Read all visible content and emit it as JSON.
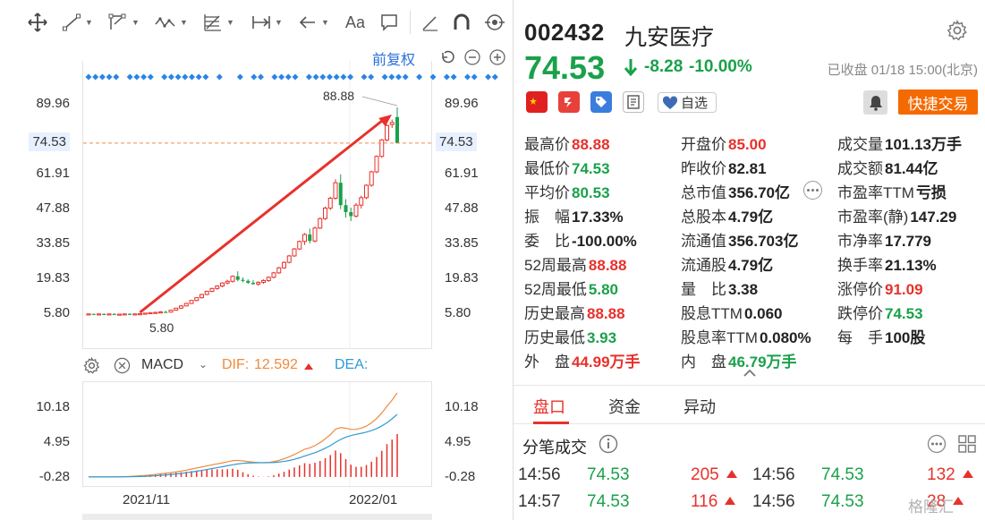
{
  "left": {
    "fq_label": "前复权",
    "axis_left": [
      "89.96",
      "74.53",
      "61.91",
      "47.88",
      "33.85",
      "19.83",
      "5.80"
    ],
    "axis_right": [
      "89.96",
      "74.53",
      "61.91",
      "47.88",
      "33.85",
      "19.83",
      "5.80"
    ],
    "high_marker": "88.88",
    "low_marker": "5.80",
    "macd": {
      "indicator": "MACD",
      "dif_label": "DIF:",
      "dif_value": "12.592",
      "dea_label": "DEA:",
      "axis_left": [
        "10.18",
        "4.95",
        "-0.28"
      ],
      "axis_right": [
        "10.18",
        "4.95",
        "-0.28"
      ]
    },
    "dates": [
      "2021/11",
      "2022/01"
    ]
  },
  "quote": {
    "code": "002432",
    "name": "九安医疗",
    "price": "74.53",
    "change": "-8.28",
    "change_pct": "-10.00%",
    "status": "已收盘 01/18 15:00(北京)",
    "fav_label": "自选",
    "trade_label": "快捷交易",
    "stats": [
      {
        "k": "最高价",
        "v": "88.88",
        "c": "red"
      },
      {
        "k": "开盘价",
        "v": "85.00",
        "c": "red"
      },
      {
        "k": "成交量",
        "v": "101.13万手",
        "c": "dark"
      },
      {
        "k": "最低价",
        "v": "74.53",
        "c": "green"
      },
      {
        "k": "昨收价",
        "v": "82.81",
        "c": "dark"
      },
      {
        "k": "成交额",
        "v": "81.44亿",
        "c": "dark"
      },
      {
        "k": "平均价",
        "v": "80.53",
        "c": "green"
      },
      {
        "k": "总市值",
        "v": "356.70亿",
        "c": "dark"
      },
      {
        "k": "市盈率TTM",
        "v": "亏损",
        "c": "dark"
      },
      {
        "k": "振　幅",
        "v": "17.33%",
        "c": "dark"
      },
      {
        "k": "总股本",
        "v": "4.79亿",
        "c": "dark"
      },
      {
        "k": "市盈率(静)",
        "v": "147.29",
        "c": "dark"
      },
      {
        "k": "委　比",
        "v": "-100.00%",
        "c": "dark"
      },
      {
        "k": "流通值",
        "v": "356.703亿",
        "c": "dark"
      },
      {
        "k": "市净率",
        "v": "17.779",
        "c": "dark"
      },
      {
        "k": "52周最高",
        "v": "88.88",
        "c": "red"
      },
      {
        "k": "流通股",
        "v": "4.79亿",
        "c": "dark"
      },
      {
        "k": "换手率",
        "v": "21.13%",
        "c": "dark"
      },
      {
        "k": "52周最低",
        "v": "5.80",
        "c": "green"
      },
      {
        "k": "量　比",
        "v": "3.38",
        "c": "dark"
      },
      {
        "k": "涨停价",
        "v": "91.09",
        "c": "red"
      },
      {
        "k": "历史最高",
        "v": "88.88",
        "c": "red"
      },
      {
        "k": "股息TTM",
        "v": "0.060",
        "c": "dark"
      },
      {
        "k": "跌停价",
        "v": "74.53",
        "c": "green"
      },
      {
        "k": "历史最低",
        "v": "3.93",
        "c": "green"
      },
      {
        "k": "股息率TTM",
        "v": "0.080%",
        "c": "dark"
      },
      {
        "k": "每　手",
        "v": "100股",
        "c": "dark"
      },
      {
        "k": "外　盘",
        "v": "44.99万手",
        "c": "red"
      },
      {
        "k": "内　盘",
        "v": "46.79万手",
        "c": "green"
      }
    ],
    "tabs": [
      "盘口",
      "资金",
      "异动"
    ],
    "ticks_title": "分笔成交",
    "ticks": [
      {
        "time": "14:56",
        "price": "74.53",
        "vol": "205",
        "time2": "14:56",
        "price2": "74.53",
        "vol2": "132"
      },
      {
        "time": "14:57",
        "price": "74.53",
        "vol": "116",
        "time2": "14:56",
        "price2": "74.53",
        "vol2": "28"
      }
    ],
    "watermark": "格隆汇"
  },
  "chart_data": [
    {
      "type": "candlestick",
      "title": "",
      "ylabel": "",
      "ylim": [
        0,
        96
      ],
      "yticks": [
        89.96,
        74.53,
        61.91,
        47.88,
        33.85,
        19.83,
        5.8
      ],
      "xticks": [
        "2021/11",
        "2022/01"
      ],
      "marked_high": 88.88,
      "marked_low": 5.8,
      "last_close": 74.53,
      "candles": [
        {
          "o": 5.8,
          "h": 6.0,
          "l": 5.6,
          "c": 5.9
        },
        {
          "o": 5.9,
          "h": 6.0,
          "l": 5.7,
          "c": 5.8
        },
        {
          "o": 5.8,
          "h": 6.0,
          "l": 5.6,
          "c": 5.9
        },
        {
          "o": 5.9,
          "h": 6.1,
          "l": 5.7,
          "c": 5.8
        },
        {
          "o": 5.8,
          "h": 6.0,
          "l": 5.6,
          "c": 5.9
        },
        {
          "o": 5.9,
          "h": 6.1,
          "l": 5.7,
          "c": 5.8
        },
        {
          "o": 5.8,
          "h": 6.0,
          "l": 5.6,
          "c": 5.8
        },
        {
          "o": 5.8,
          "h": 6.0,
          "l": 5.6,
          "c": 5.9
        },
        {
          "o": 5.9,
          "h": 6.1,
          "l": 5.7,
          "c": 5.8
        },
        {
          "o": 5.8,
          "h": 6.0,
          "l": 5.6,
          "c": 5.9
        },
        {
          "o": 5.9,
          "h": 6.2,
          "l": 5.8,
          "c": 6.0
        },
        {
          "o": 6.0,
          "h": 6.3,
          "l": 5.9,
          "c": 6.2
        },
        {
          "o": 6.2,
          "h": 6.6,
          "l": 6.1,
          "c": 6.4
        },
        {
          "o": 6.4,
          "h": 6.8,
          "l": 6.2,
          "c": 6.5
        },
        {
          "o": 6.5,
          "h": 7.0,
          "l": 6.3,
          "c": 6.7
        },
        {
          "o": 6.7,
          "h": 7.2,
          "l": 6.5,
          "c": 6.6
        },
        {
          "o": 6.6,
          "h": 7.6,
          "l": 6.5,
          "c": 7.4
        },
        {
          "o": 7.4,
          "h": 8.4,
          "l": 7.2,
          "c": 8.2
        },
        {
          "o": 8.2,
          "h": 9.4,
          "l": 8.0,
          "c": 9.1
        },
        {
          "o": 9.1,
          "h": 10.4,
          "l": 8.9,
          "c": 10.1
        },
        {
          "o": 10.1,
          "h": 11.6,
          "l": 9.9,
          "c": 11.3
        },
        {
          "o": 11.3,
          "h": 12.6,
          "l": 11.0,
          "c": 12.4
        },
        {
          "o": 12.4,
          "h": 14.0,
          "l": 12.1,
          "c": 13.7
        },
        {
          "o": 13.7,
          "h": 15.2,
          "l": 13.4,
          "c": 15.0
        },
        {
          "o": 15.0,
          "h": 16.4,
          "l": 14.6,
          "c": 16.1
        },
        {
          "o": 16.1,
          "h": 17.4,
          "l": 15.6,
          "c": 17.1
        },
        {
          "o": 17.1,
          "h": 18.6,
          "l": 16.6,
          "c": 18.3
        },
        {
          "o": 18.3,
          "h": 19.6,
          "l": 17.8,
          "c": 19.0
        },
        {
          "o": 19.0,
          "h": 21.4,
          "l": 18.5,
          "c": 21.0
        },
        {
          "o": 21.0,
          "h": 23.0,
          "l": 19.0,
          "c": 19.6
        },
        {
          "o": 19.6,
          "h": 20.6,
          "l": 18.6,
          "c": 19.2
        },
        {
          "o": 19.2,
          "h": 19.8,
          "l": 18.0,
          "c": 18.4
        },
        {
          "o": 18.4,
          "h": 19.4,
          "l": 17.6,
          "c": 17.9
        },
        {
          "o": 17.9,
          "h": 19.0,
          "l": 17.2,
          "c": 18.6
        },
        {
          "o": 18.6,
          "h": 19.8,
          "l": 18.0,
          "c": 19.3
        },
        {
          "o": 19.3,
          "h": 21.0,
          "l": 18.8,
          "c": 20.6
        },
        {
          "o": 20.6,
          "h": 22.8,
          "l": 20.2,
          "c": 22.4
        },
        {
          "o": 22.4,
          "h": 24.8,
          "l": 22.0,
          "c": 24.4
        },
        {
          "o": 24.4,
          "h": 27.0,
          "l": 24.0,
          "c": 26.6
        },
        {
          "o": 26.6,
          "h": 29.6,
          "l": 26.2,
          "c": 29.2
        },
        {
          "o": 29.2,
          "h": 32.4,
          "l": 28.8,
          "c": 32.0
        },
        {
          "o": 32.0,
          "h": 35.4,
          "l": 31.6,
          "c": 35.0
        },
        {
          "o": 35.0,
          "h": 38.4,
          "l": 33.6,
          "c": 37.8
        },
        {
          "o": 37.8,
          "h": 40.2,
          "l": 34.2,
          "c": 35.2
        },
        {
          "o": 35.2,
          "h": 41.0,
          "l": 34.6,
          "c": 40.4
        },
        {
          "o": 40.4,
          "h": 44.6,
          "l": 40.0,
          "c": 44.2
        },
        {
          "o": 44.2,
          "h": 49.0,
          "l": 43.6,
          "c": 48.4
        },
        {
          "o": 48.4,
          "h": 53.0,
          "l": 47.6,
          "c": 52.4
        },
        {
          "o": 52.4,
          "h": 60.0,
          "l": 51.8,
          "c": 58.6
        },
        {
          "o": 58.6,
          "h": 62.0,
          "l": 48.0,
          "c": 49.6
        },
        {
          "o": 49.6,
          "h": 52.0,
          "l": 44.6,
          "c": 46.8
        },
        {
          "o": 46.8,
          "h": 48.6,
          "l": 43.2,
          "c": 45.2
        },
        {
          "o": 45.2,
          "h": 50.4,
          "l": 44.6,
          "c": 49.6
        },
        {
          "o": 49.6,
          "h": 53.4,
          "l": 48.2,
          "c": 52.6
        },
        {
          "o": 52.6,
          "h": 58.0,
          "l": 52.0,
          "c": 57.6
        },
        {
          "o": 57.6,
          "h": 63.4,
          "l": 57.0,
          "c": 63.0
        },
        {
          "o": 63.0,
          "h": 69.6,
          "l": 62.4,
          "c": 69.2
        },
        {
          "o": 69.2,
          "h": 76.2,
          "l": 68.6,
          "c": 75.8
        },
        {
          "o": 75.8,
          "h": 82.0,
          "l": 75.2,
          "c": 81.6
        },
        {
          "o": 82.0,
          "h": 84.0,
          "l": 80.6,
          "c": 82.81
        },
        {
          "o": 85.0,
          "h": 88.88,
          "l": 74.53,
          "c": 74.53
        }
      ]
    },
    {
      "type": "macd",
      "title": "MACD",
      "ylim": [
        -1.5,
        13.5
      ],
      "yticks": [
        10.18,
        4.95,
        -0.28
      ],
      "xticks": [
        "2021/11",
        "2022/01"
      ],
      "dif_last": 12.592,
      "series": [
        {
          "name": "DIF",
          "values": [
            0,
            0,
            0,
            0,
            0.01,
            0.02,
            0.03,
            0.05,
            0.08,
            0.12,
            0.17,
            0.23,
            0.3,
            0.38,
            0.47,
            0.56,
            0.65,
            0.76,
            0.88,
            1.02,
            1.18,
            1.34,
            1.5,
            1.66,
            1.82,
            1.96,
            2.1,
            2.26,
            2.44,
            2.48,
            2.4,
            2.3,
            2.22,
            2.16,
            2.14,
            2.18,
            2.3,
            2.48,
            2.72,
            3.02,
            3.36,
            3.74,
            4.16,
            4.36,
            4.7,
            5.14,
            5.7,
            6.34,
            7.16,
            7.4,
            7.3,
            7.12,
            7.14,
            7.3,
            7.62,
            8.1,
            8.76,
            9.6,
            10.58,
            11.52,
            12.592
          ]
        },
        {
          "name": "DEA",
          "values": [
            0,
            0,
            0,
            0,
            0,
            0.01,
            0.01,
            0.02,
            0.03,
            0.05,
            0.07,
            0.1,
            0.14,
            0.18,
            0.24,
            0.3,
            0.37,
            0.44,
            0.53,
            0.63,
            0.74,
            0.86,
            0.99,
            1.12,
            1.26,
            1.39,
            1.53,
            1.68,
            1.82,
            1.95,
            2.04,
            2.1,
            2.12,
            2.13,
            2.13,
            2.14,
            2.17,
            2.23,
            2.33,
            2.47,
            2.65,
            2.87,
            3.13,
            3.38,
            3.64,
            3.94,
            4.3,
            4.7,
            5.18,
            5.62,
            5.96,
            6.2,
            6.38,
            6.54,
            6.72,
            6.96,
            7.26,
            7.64,
            8.12,
            8.72,
            9.38
          ]
        }
      ]
    }
  ]
}
